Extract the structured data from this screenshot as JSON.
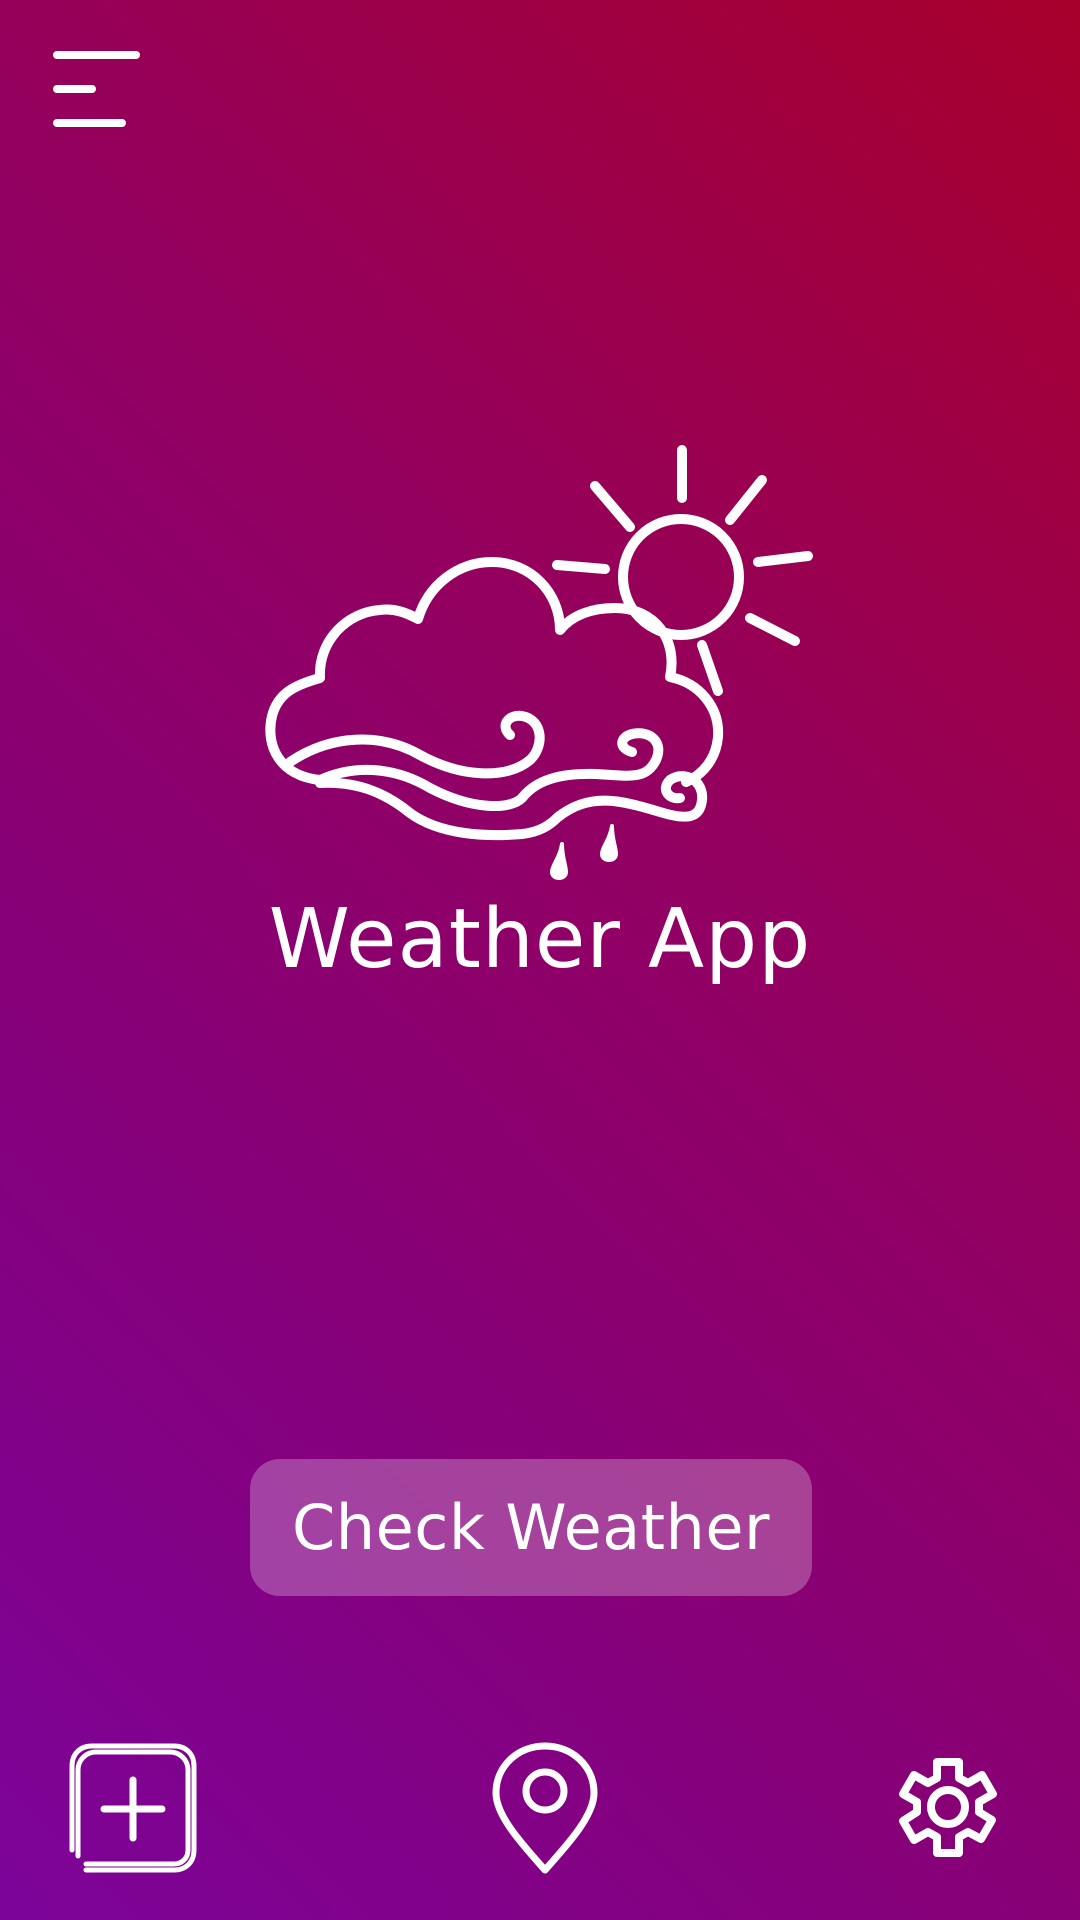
{
  "app": {
    "title": "Weather App"
  },
  "header": {
    "menu_icon": "hamburger-menu-icon"
  },
  "hero": {
    "icon": "cloud-sun-wind-rain-icon"
  },
  "main": {
    "check_button_label": "Check Weather"
  },
  "bottom_nav": {
    "items": [
      {
        "icon": "add-square-icon"
      },
      {
        "icon": "location-pin-icon"
      },
      {
        "icon": "gear-icon"
      }
    ]
  },
  "colors": {
    "background_top_right": "#a8002c",
    "background_bottom_left": "#7c0499",
    "foreground": "#ffffff",
    "button_fill": "rgba(255,255,255,0.26)"
  }
}
